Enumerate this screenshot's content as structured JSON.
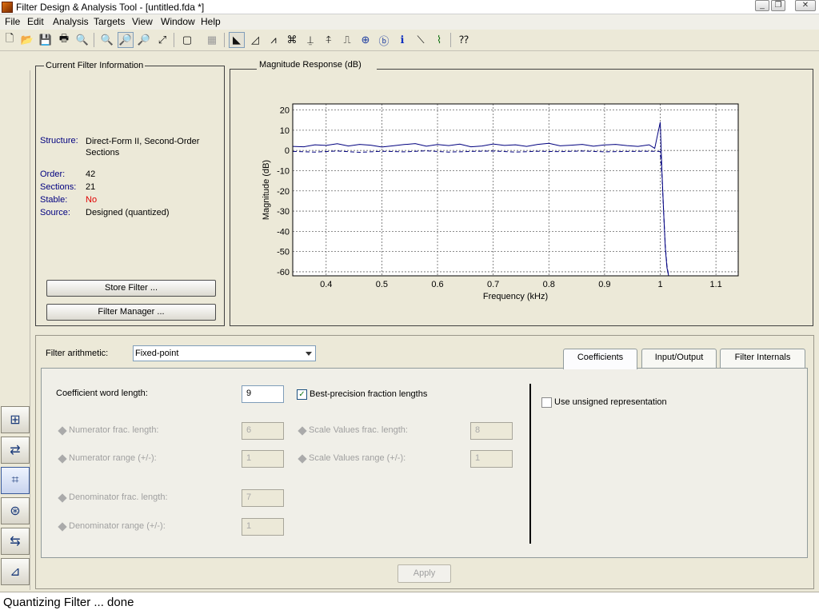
{
  "window": {
    "title": "Filter Design & Analysis Tool -  [untitled.fda *]",
    "minimize_glyph": "_",
    "restore_glyph": "❐",
    "close_glyph": "✕"
  },
  "menu": [
    "File",
    "Edit",
    "Analysis",
    "Targets",
    "View",
    "Window",
    "Help"
  ],
  "toolbar": {
    "icons": [
      "new-icon",
      "open-icon",
      "save-icon",
      "print-icon",
      "print-preview-icon",
      "zoom-in-icon",
      "zoom-x-icon",
      "zoom-y-icon",
      "full-view-icon",
      "new-figure-icon",
      "legend-icon",
      "magnitude-response-icon",
      "phase-response-icon",
      "magnitude-phase-icon",
      "group-delay-icon",
      "phase-delay-icon",
      "impulse-response-icon",
      "step-response-icon",
      "pole-zero-icon",
      "coefficients-icon",
      "filter-info-icon",
      "magnitude-estimate-icon",
      "round-off-noise-icon",
      "whats-this-icon"
    ],
    "glyphs": [
      "🗋",
      "📂",
      "💾",
      "🖶",
      "🔍",
      "🔍",
      "🔎",
      "🔎",
      "⤢",
      "▢",
      "▦",
      "◣",
      "◿",
      "⩘",
      "⌘",
      "⍊",
      "⍏",
      "⎍",
      "⊕",
      "ⓑ",
      "ℹ",
      "⟍",
      "⌇",
      "⁇"
    ]
  },
  "filter_info": {
    "group_label": "Current Filter Information",
    "rows": [
      {
        "label": "Structure:",
        "value": "Direct-Form II, Second-Order Sections"
      },
      {
        "label": "Order:",
        "value": "42"
      },
      {
        "label": "Sections:",
        "value": "21"
      },
      {
        "label": "Stable:",
        "value": "No"
      },
      {
        "label": "Source:",
        "value": "Designed (quantized)"
      }
    ],
    "store_filter_label": "Store Filter ...",
    "filter_manager_label": "Filter Manager ..."
  },
  "plot": {
    "group_label": "Magnitude Response (dB)"
  },
  "chart_data": {
    "type": "line",
    "xlabel": "Frequency (kHz)",
    "ylabel": "Magnitude (dB)",
    "xlim": [
      0.34,
      1.14
    ],
    "ylim": [
      -62,
      23
    ],
    "xticks": [
      0.4,
      0.5,
      0.6,
      0.7,
      0.8,
      0.9,
      1.0,
      1.1
    ],
    "xtick_labels": [
      "0.4",
      "0.5",
      "0.6",
      "0.7",
      "0.8",
      "0.9",
      "1",
      "1.1"
    ],
    "yticks": [
      20,
      10,
      0,
      -10,
      -20,
      -30,
      -40,
      -50,
      -60
    ],
    "grid": true,
    "series": [
      {
        "style": "solid",
        "color": "#00007f",
        "x": [
          0.34,
          0.36,
          0.38,
          0.4,
          0.42,
          0.44,
          0.46,
          0.48,
          0.5,
          0.52,
          0.54,
          0.56,
          0.58,
          0.6,
          0.62,
          0.64,
          0.66,
          0.68,
          0.7,
          0.72,
          0.74,
          0.76,
          0.78,
          0.8,
          0.82,
          0.84,
          0.86,
          0.88,
          0.9,
          0.92,
          0.94,
          0.96,
          0.98,
          0.99,
          1.0,
          1.003,
          1.006,
          1.009,
          1.012,
          1.015
        ],
        "y": [
          2,
          1.8,
          2.8,
          2.5,
          3.3,
          2.2,
          3.0,
          2.6,
          1.7,
          2.3,
          2.9,
          3.4,
          2.1,
          2.9,
          2.4,
          3.1,
          1.8,
          2.2,
          3.2,
          2.5,
          2.8,
          2.0,
          3.0,
          3.5,
          2.3,
          2.6,
          3.0,
          2.1,
          2.7,
          3.0,
          2.4,
          2.0,
          2.8,
          1.0,
          14,
          -10,
          -30,
          -48,
          -58,
          -62
        ]
      },
      {
        "style": "dashed",
        "color": "#00007f",
        "x": [
          0.34,
          0.38,
          0.42,
          0.46,
          0.5,
          0.54,
          0.58,
          0.62,
          0.66,
          0.7,
          0.74,
          0.78,
          0.82,
          0.86,
          0.9,
          0.94,
          0.98,
          1.0,
          1.003,
          1.006,
          1.009,
          1.012,
          1.015
        ],
        "y": [
          -0.5,
          -0.8,
          -0.3,
          -0.9,
          -0.4,
          -0.7,
          -0.2,
          -0.8,
          -0.5,
          -0.3,
          -0.8,
          -0.4,
          -0.6,
          -0.3,
          -0.7,
          -0.5,
          -0.4,
          -0.5,
          -12,
          -30,
          -47,
          -57,
          -62
        ]
      }
    ]
  },
  "arith": {
    "label": "Filter arithmetic:",
    "value": "Fixed-point"
  },
  "tabs": [
    "Coefficients",
    "Input/Output",
    "Filter Internals"
  ],
  "coeffs": {
    "word_length_label": "Coefficient word length:",
    "word_length_value": "9",
    "best_precision_label": "Best-precision fraction lengths",
    "check_mark": "✓",
    "num_frac_label": "Numerator frac. length:",
    "num_frac_value": "6",
    "num_range_label": "Numerator range (+/-):",
    "num_range_value": "1",
    "scale_frac_label": "Scale Values frac. length:",
    "scale_frac_value": "8",
    "scale_range_label": "Scale Values range (+/-):",
    "scale_range_value": "1",
    "den_frac_label": "Denominator frac. length:",
    "den_frac_value": "7",
    "den_range_label": "Denominator range (+/-):",
    "den_range_value": "1",
    "unsigned_label": "Use unsigned representation"
  },
  "side_buttons": [
    {
      "name": "transform-filter-icon",
      "glyph": "⊞"
    },
    {
      "name": "convert-structure-icon",
      "glyph": "⇄"
    },
    {
      "name": "set-quantization-icon",
      "glyph": "⌗"
    },
    {
      "name": "pole-zero-editor-icon",
      "glyph": "⊛"
    },
    {
      "name": "multirate-icon",
      "glyph": "⇆"
    },
    {
      "name": "design-filter-icon",
      "glyph": "⊿"
    }
  ],
  "apply_label": "Apply",
  "status": "Quantizing Filter ... done"
}
